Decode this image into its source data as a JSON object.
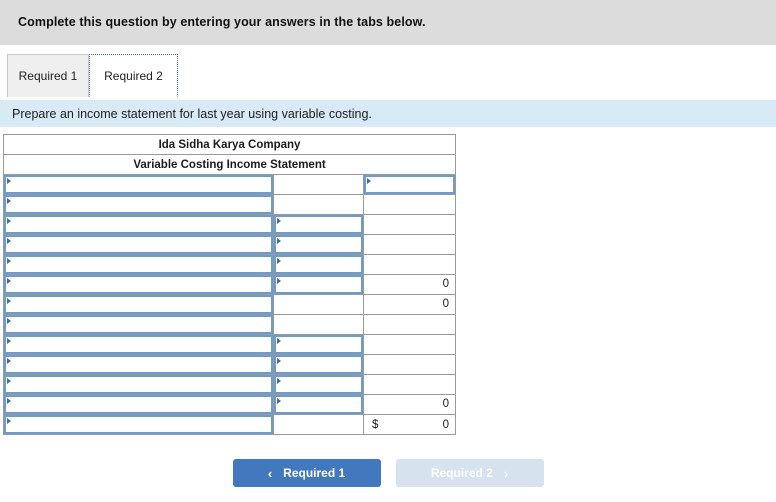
{
  "banner": {
    "text": "Complete this question by entering your answers in the tabs below."
  },
  "tabs": [
    {
      "label": "Required 1",
      "active": false
    },
    {
      "label": "Required 2",
      "active": true
    }
  ],
  "prompt": {
    "text": "Prepare an income statement for last year using variable costing."
  },
  "worksheet": {
    "title_line1": "Ida Sidha Karya Company",
    "title_line2": "Variable Costing Income Statement",
    "rows": [
      {
        "label": "",
        "middle": "",
        "right": ""
      },
      {
        "label": "",
        "middle": "",
        "right": ""
      },
      {
        "label": "",
        "middle": "",
        "right": ""
      },
      {
        "label": "",
        "middle": "",
        "right": ""
      },
      {
        "label": "",
        "middle": "",
        "right": ""
      },
      {
        "label": "",
        "middle": "",
        "right": "0"
      },
      {
        "label": "",
        "middle": "",
        "right": "0"
      },
      {
        "label": "",
        "middle": "",
        "right": ""
      },
      {
        "label": "",
        "middle": "",
        "right": ""
      },
      {
        "label": "",
        "middle": "",
        "right": ""
      },
      {
        "label": "",
        "middle": "",
        "right": ""
      },
      {
        "label": "",
        "middle": "",
        "right": "0"
      },
      {
        "label": "",
        "middle": "",
        "right": "0"
      }
    ],
    "currency_symbol": "$"
  },
  "navigation": {
    "prev_label": "Required 1",
    "prev_chevron": "‹",
    "next_label": "Required 2",
    "next_chevron": "›"
  },
  "colors": {
    "banner_bg": "#dcdcdc",
    "prompt_bg": "#d7eaf6",
    "sheet_header_bg": "#7dade0",
    "cell_border_blue": "#6f9bc8",
    "button_active_bg": "#4178be",
    "button_disabled_bg": "#d6e3ef"
  }
}
